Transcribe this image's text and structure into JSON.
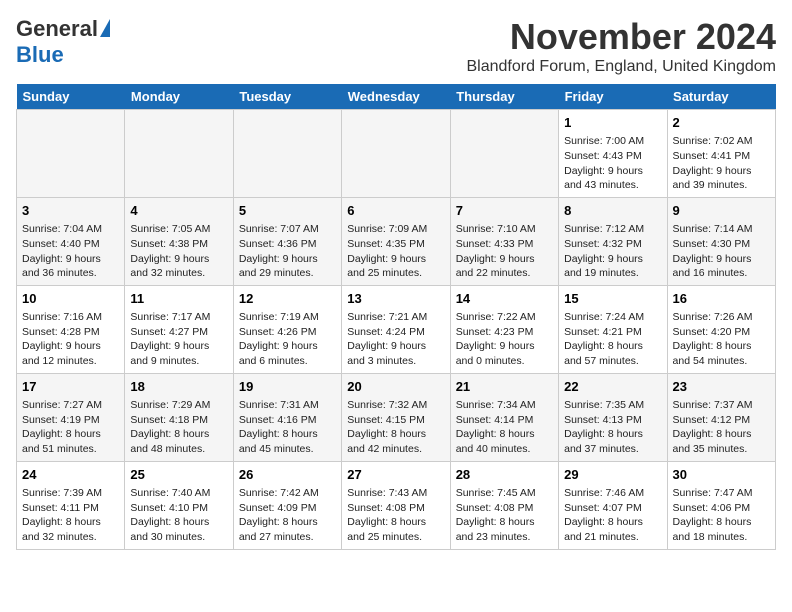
{
  "header": {
    "logo_general": "General",
    "logo_blue": "Blue",
    "month_title": "November 2024",
    "location": "Blandford Forum, England, United Kingdom"
  },
  "days_of_week": [
    "Sunday",
    "Monday",
    "Tuesday",
    "Wednesday",
    "Thursday",
    "Friday",
    "Saturday"
  ],
  "weeks": [
    [
      {
        "day": "",
        "info": ""
      },
      {
        "day": "",
        "info": ""
      },
      {
        "day": "",
        "info": ""
      },
      {
        "day": "",
        "info": ""
      },
      {
        "day": "",
        "info": ""
      },
      {
        "day": "1",
        "info": "Sunrise: 7:00 AM\nSunset: 4:43 PM\nDaylight: 9 hours and 43 minutes."
      },
      {
        "day": "2",
        "info": "Sunrise: 7:02 AM\nSunset: 4:41 PM\nDaylight: 9 hours and 39 minutes."
      }
    ],
    [
      {
        "day": "3",
        "info": "Sunrise: 7:04 AM\nSunset: 4:40 PM\nDaylight: 9 hours and 36 minutes."
      },
      {
        "day": "4",
        "info": "Sunrise: 7:05 AM\nSunset: 4:38 PM\nDaylight: 9 hours and 32 minutes."
      },
      {
        "day": "5",
        "info": "Sunrise: 7:07 AM\nSunset: 4:36 PM\nDaylight: 9 hours and 29 minutes."
      },
      {
        "day": "6",
        "info": "Sunrise: 7:09 AM\nSunset: 4:35 PM\nDaylight: 9 hours and 25 minutes."
      },
      {
        "day": "7",
        "info": "Sunrise: 7:10 AM\nSunset: 4:33 PM\nDaylight: 9 hours and 22 minutes."
      },
      {
        "day": "8",
        "info": "Sunrise: 7:12 AM\nSunset: 4:32 PM\nDaylight: 9 hours and 19 minutes."
      },
      {
        "day": "9",
        "info": "Sunrise: 7:14 AM\nSunset: 4:30 PM\nDaylight: 9 hours and 16 minutes."
      }
    ],
    [
      {
        "day": "10",
        "info": "Sunrise: 7:16 AM\nSunset: 4:28 PM\nDaylight: 9 hours and 12 minutes."
      },
      {
        "day": "11",
        "info": "Sunrise: 7:17 AM\nSunset: 4:27 PM\nDaylight: 9 hours and 9 minutes."
      },
      {
        "day": "12",
        "info": "Sunrise: 7:19 AM\nSunset: 4:26 PM\nDaylight: 9 hours and 6 minutes."
      },
      {
        "day": "13",
        "info": "Sunrise: 7:21 AM\nSunset: 4:24 PM\nDaylight: 9 hours and 3 minutes."
      },
      {
        "day": "14",
        "info": "Sunrise: 7:22 AM\nSunset: 4:23 PM\nDaylight: 9 hours and 0 minutes."
      },
      {
        "day": "15",
        "info": "Sunrise: 7:24 AM\nSunset: 4:21 PM\nDaylight: 8 hours and 57 minutes."
      },
      {
        "day": "16",
        "info": "Sunrise: 7:26 AM\nSunset: 4:20 PM\nDaylight: 8 hours and 54 minutes."
      }
    ],
    [
      {
        "day": "17",
        "info": "Sunrise: 7:27 AM\nSunset: 4:19 PM\nDaylight: 8 hours and 51 minutes."
      },
      {
        "day": "18",
        "info": "Sunrise: 7:29 AM\nSunset: 4:18 PM\nDaylight: 8 hours and 48 minutes."
      },
      {
        "day": "19",
        "info": "Sunrise: 7:31 AM\nSunset: 4:16 PM\nDaylight: 8 hours and 45 minutes."
      },
      {
        "day": "20",
        "info": "Sunrise: 7:32 AM\nSunset: 4:15 PM\nDaylight: 8 hours and 42 minutes."
      },
      {
        "day": "21",
        "info": "Sunrise: 7:34 AM\nSunset: 4:14 PM\nDaylight: 8 hours and 40 minutes."
      },
      {
        "day": "22",
        "info": "Sunrise: 7:35 AM\nSunset: 4:13 PM\nDaylight: 8 hours and 37 minutes."
      },
      {
        "day": "23",
        "info": "Sunrise: 7:37 AM\nSunset: 4:12 PM\nDaylight: 8 hours and 35 minutes."
      }
    ],
    [
      {
        "day": "24",
        "info": "Sunrise: 7:39 AM\nSunset: 4:11 PM\nDaylight: 8 hours and 32 minutes."
      },
      {
        "day": "25",
        "info": "Sunrise: 7:40 AM\nSunset: 4:10 PM\nDaylight: 8 hours and 30 minutes."
      },
      {
        "day": "26",
        "info": "Sunrise: 7:42 AM\nSunset: 4:09 PM\nDaylight: 8 hours and 27 minutes."
      },
      {
        "day": "27",
        "info": "Sunrise: 7:43 AM\nSunset: 4:08 PM\nDaylight: 8 hours and 25 minutes."
      },
      {
        "day": "28",
        "info": "Sunrise: 7:45 AM\nSunset: 4:08 PM\nDaylight: 8 hours and 23 minutes."
      },
      {
        "day": "29",
        "info": "Sunrise: 7:46 AM\nSunset: 4:07 PM\nDaylight: 8 hours and 21 minutes."
      },
      {
        "day": "30",
        "info": "Sunrise: 7:47 AM\nSunset: 4:06 PM\nDaylight: 8 hours and 18 minutes."
      }
    ]
  ]
}
